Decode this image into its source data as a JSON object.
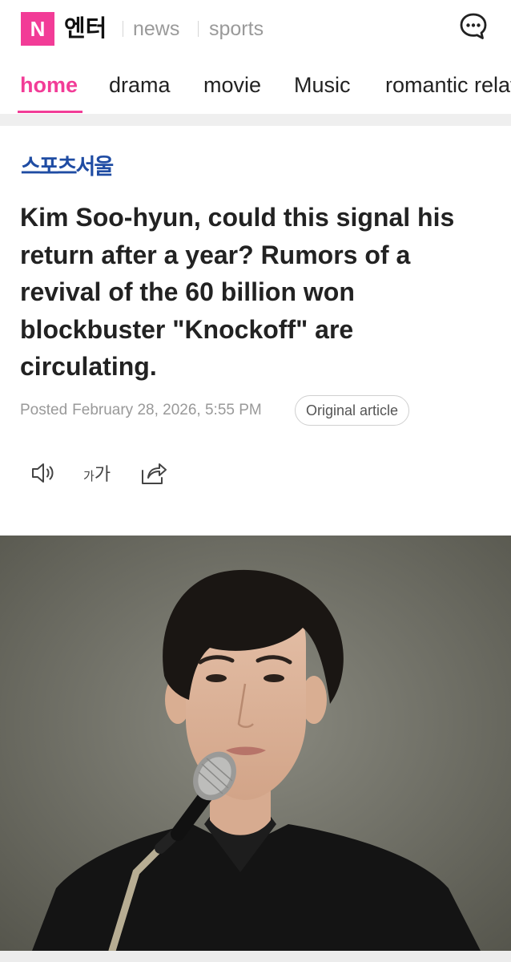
{
  "header": {
    "logo_letter": "N",
    "logo_word": "엔터",
    "links": [
      "news",
      "sports"
    ],
    "chat_icon": "chat-bubble-dots-icon"
  },
  "tabs": [
    {
      "label": "home",
      "active": true
    },
    {
      "label": "drama",
      "active": false
    },
    {
      "label": "movie",
      "active": false
    },
    {
      "label": "Music",
      "active": false
    },
    {
      "label": "romantic relationship",
      "active": false
    }
  ],
  "article": {
    "press": "스포츠서울",
    "headline": "Kim Soo-hyun, could this signal his return after a year? Rumors of a revival of the 60 billion won blockbuster \"Knockoff\" are circulating.",
    "posted_label": "Posted",
    "posted_date": "February 28, 2026, 5:55 PM",
    "original_button": "Original article",
    "font_size_small": "가",
    "font_size_big": "가"
  },
  "toolbar_icons": [
    "speaker-icon",
    "font-size-icon",
    "share-icon"
  ],
  "colors": {
    "accent": "#f23c97",
    "press_blue": "#1f4ca3",
    "meta_gray": "#999999"
  },
  "photo": {
    "subject": "man-speaking-at-microphone"
  }
}
